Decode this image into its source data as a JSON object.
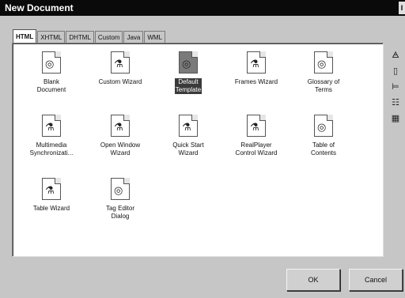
{
  "window": {
    "title": "New Document",
    "title_button": "I"
  },
  "tabs": [
    {
      "label": "HTML",
      "active": true
    },
    {
      "label": "XHTML",
      "active": false
    },
    {
      "label": "DHTML",
      "active": false
    },
    {
      "label": "Custom",
      "active": false
    },
    {
      "label": "Java",
      "active": false
    },
    {
      "label": "WML",
      "active": false
    }
  ],
  "items": [
    {
      "label": "Blank\nDocument",
      "icon": "globe-doc-icon",
      "selected": false
    },
    {
      "label": "Custom Wizard",
      "icon": "wizard-icon",
      "selected": false
    },
    {
      "label": "Default\nTemplate",
      "icon": "globe-doc-icon",
      "selected": true
    },
    {
      "label": "Frames Wizard",
      "icon": "wizard-icon",
      "selected": false
    },
    {
      "label": "Glossary of\nTerms",
      "icon": "globe-doc-icon",
      "selected": false
    },
    {
      "label": "Multimedia\nSynchronizati...",
      "icon": "wizard-icon",
      "selected": false
    },
    {
      "label": "Open Window\nWizard",
      "icon": "wizard-icon",
      "selected": false
    },
    {
      "label": "Quick Start\nWizard",
      "icon": "wizard-icon",
      "selected": false
    },
    {
      "label": "RealPlayer\nControl Wizard",
      "icon": "wizard-icon",
      "selected": false
    },
    {
      "label": "Table of\nContents",
      "icon": "globe-doc-icon",
      "selected": false
    },
    {
      "label": "Table Wizard",
      "icon": "wizard-icon",
      "selected": false
    },
    {
      "label": "Tag Editor\nDialog",
      "icon": "globe-doc-icon",
      "selected": false
    }
  ],
  "side_tools": [
    "wizard-icon",
    "blank-page-icon",
    "tree-icon",
    "list-view-icon",
    "grid-view-icon"
  ],
  "buttons": {
    "ok": "OK",
    "cancel": "Cancel"
  }
}
